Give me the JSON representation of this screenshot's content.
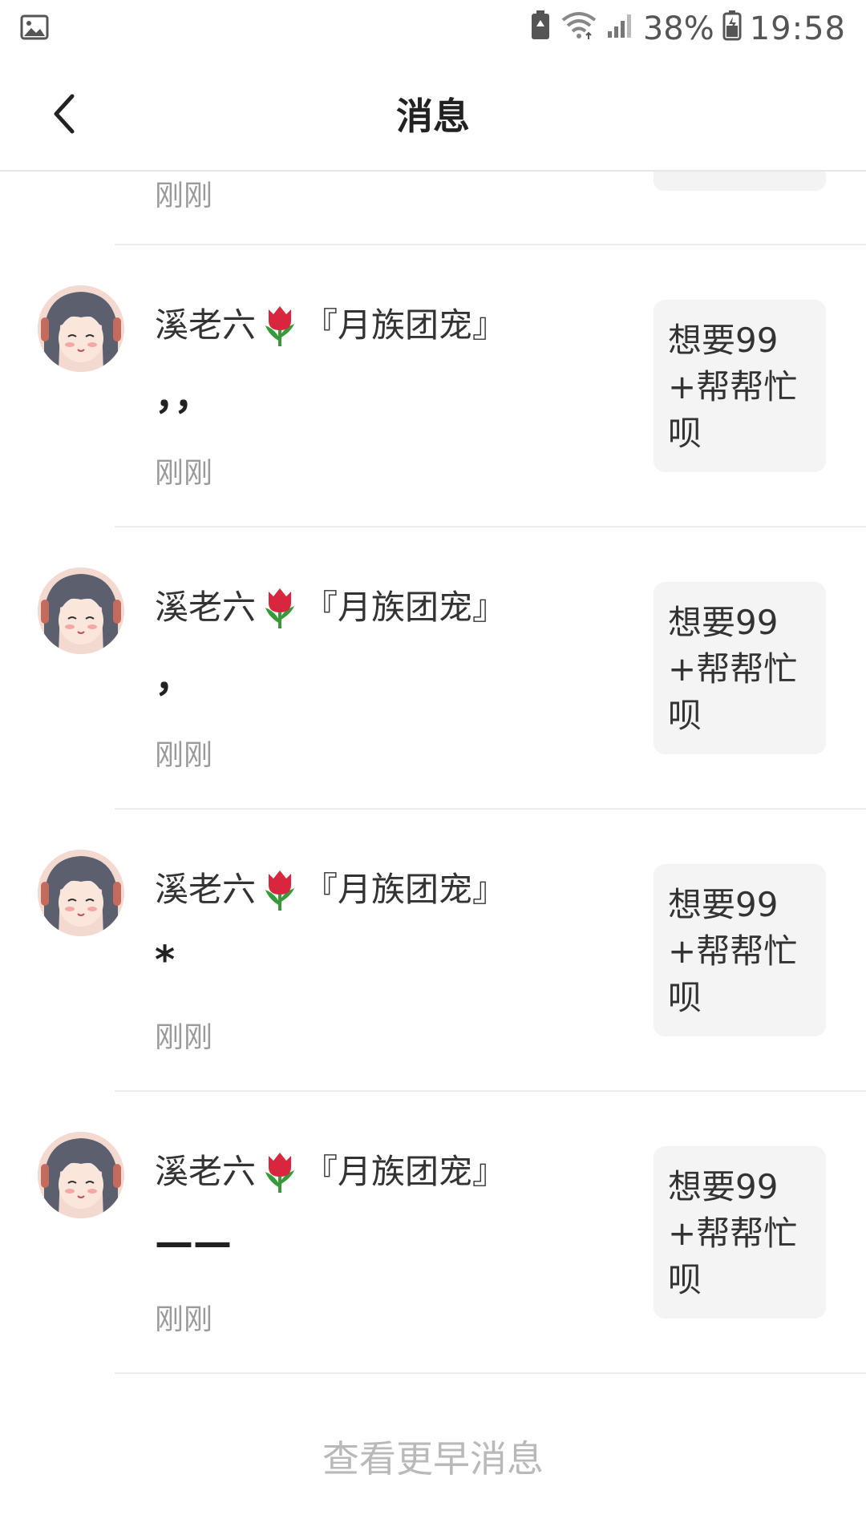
{
  "status_bar": {
    "battery": "38%",
    "time": "19:58"
  },
  "header": {
    "title": "消息"
  },
  "partial_row": {
    "time": "刚刚"
  },
  "messages": [
    {
      "sender": "溪老六",
      "sender_suffix": "『月族团宠』",
      "content": "，，",
      "time": "刚刚",
      "reply": "想要99+帮帮忙呗"
    },
    {
      "sender": "溪老六",
      "sender_suffix": "『月族团宠』",
      "content": "，",
      "time": "刚刚",
      "reply": "想要99+帮帮忙呗"
    },
    {
      "sender": "溪老六",
      "sender_suffix": "『月族团宠』",
      "content": "*",
      "time": "刚刚",
      "reply": "想要99+帮帮忙呗"
    },
    {
      "sender": "溪老六",
      "sender_suffix": "『月族团宠』",
      "content": "——",
      "time": "刚刚",
      "reply": "想要99+帮帮忙呗"
    }
  ],
  "footer": {
    "more_label": "查看更早消息"
  }
}
